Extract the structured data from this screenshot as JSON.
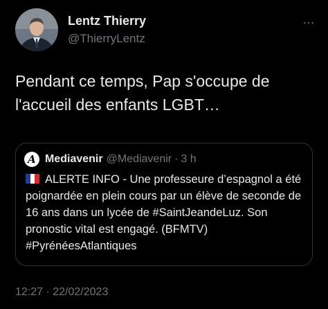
{
  "author": {
    "name": "Lentz Thierry",
    "handle": "@ThierryLentz"
  },
  "tweet_text": "Pendant ce temps, Pap s'occupe de l'accueil des enfants LGBT…",
  "quoted": {
    "name": "Mediavenir",
    "handle": "@Mediavenir",
    "separator": "·",
    "time": "3 h",
    "logo_letter": "A",
    "text": "ALERTE INFO - Une professeure d’espagnol a été poignardée en plein cours par un élève de seconde de 16 ans dans un lycée de #SaintJeandeLuz. Son pronostic vital est engagé. (BFMTV) #PyrénéesAtlantiques",
    "flag_colors": [
      "#1f3d99",
      "#ffffff",
      "#e1262d"
    ]
  },
  "timestamp": "12:27 · 22/02/2023",
  "icons": {
    "more": "…"
  }
}
